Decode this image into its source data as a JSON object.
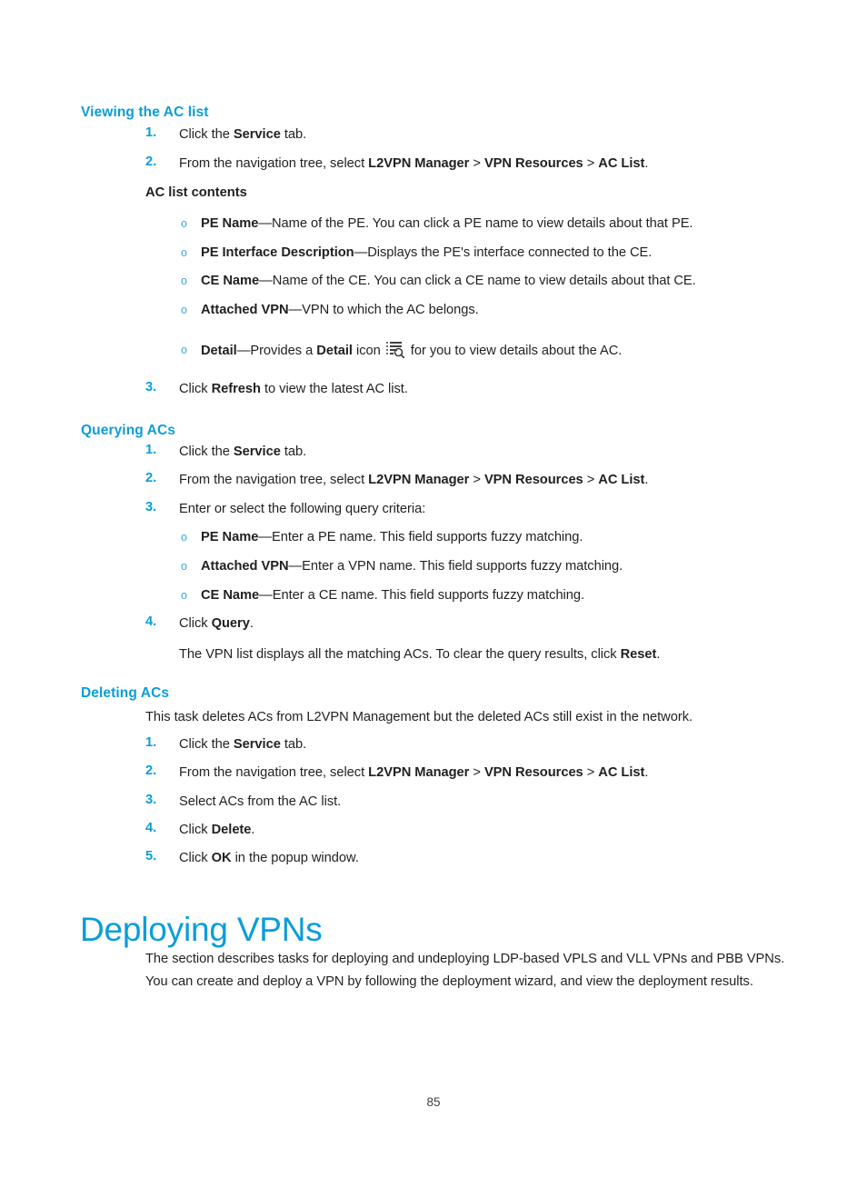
{
  "document": {
    "page_number": "85"
  },
  "sections": [
    {
      "heading": "Viewing the AC list",
      "steps": [
        {
          "num": "1.",
          "text_html": "Click the <b>Service</b> tab."
        },
        {
          "num": "2.",
          "text_html": "From the navigation tree, select <b>L2VPN Manager</b> &gt; <b>VPN Resources</b> &gt; <b>AC List</b>."
        }
      ],
      "sub_heading": "AC list contents",
      "bullets": [
        {
          "marker": "o",
          "text_html": "<b>PE Name</b>—Name of the PE. You can click a PE name to view details about that PE."
        },
        {
          "marker": "o",
          "text_html": "<b>PE Interface Description</b>—Displays the PE's interface connected to the CE."
        },
        {
          "marker": "o",
          "text_html": "<b>CE Name</b>—Name of the CE. You can click a CE name to view details about that CE."
        },
        {
          "marker": "o",
          "text_html": "<b>Attached VPN</b>—VPN to which the AC belongs."
        },
        {
          "marker": "o",
          "text_html": "<b>Detail</b>—Provides a <b>Detail</b> icon @ICON@ for you to view details about the AC."
        }
      ],
      "final_step": {
        "num": "3.",
        "text_html": "Click <b>Refresh</b> to view the latest AC list."
      }
    },
    {
      "heading": "Querying ACs",
      "steps": [
        {
          "num": "1.",
          "text_html": "Click the <b>Service</b> tab."
        },
        {
          "num": "2.",
          "text_html": "From the navigation tree, select <b>L2VPN Manager</b> &gt; <b>VPN Resources</b> &gt; <b>AC List</b>."
        },
        {
          "num": "3.",
          "text_html": "Enter or select the following query criteria:"
        }
      ],
      "bullets": [
        {
          "marker": "o",
          "text_html": "<b>PE Name</b>—Enter a PE name. This field supports fuzzy matching."
        },
        {
          "marker": "o",
          "text_html": "<b>Attached VPN</b>—Enter a VPN name. This field supports fuzzy matching."
        },
        {
          "marker": "o",
          "text_html": "<b>CE Name</b>—Enter a CE name. This field supports fuzzy matching."
        }
      ],
      "final_step": {
        "num": "4.",
        "text_html": "Click <b>Query</b>."
      },
      "note_html": "The VPN list displays all the matching ACs. To clear the query results, click <b>Reset</b>."
    },
    {
      "heading": "Deleting ACs",
      "intro_html": "This task deletes ACs from L2VPN Management but the deleted ACs still exist in the network.",
      "steps": [
        {
          "num": "1.",
          "text_html": "Click the <b>Service</b> tab."
        },
        {
          "num": "2.",
          "text_html": "From the navigation tree, select <b>L2VPN Manager</b> &gt; <b>VPN Resources</b> &gt; <b>AC List</b>."
        },
        {
          "num": "3.",
          "text_html": "Select ACs from the AC list."
        },
        {
          "num": "4.",
          "text_html": "Click <b>Delete</b>."
        },
        {
          "num": "5.",
          "text_html": "Click <b>OK</b> in the popup window."
        }
      ]
    }
  ],
  "chapter": {
    "title": "Deploying VPNs",
    "paragraph_lines": [
      "The section describes tasks for deploying and undeploying LDP-based VPLS and VLL VPNs and PBB VPNs.",
      "You can create and deploy a VPN by following the deployment wizard, and view the deployment results."
    ]
  },
  "colors": {
    "heading_blue": "#0b9dd9",
    "body_black": "#231f20",
    "bullet_blue": "#3aa7dd"
  },
  "icons": {
    "detail": "detail-list-magnifier-icon"
  }
}
